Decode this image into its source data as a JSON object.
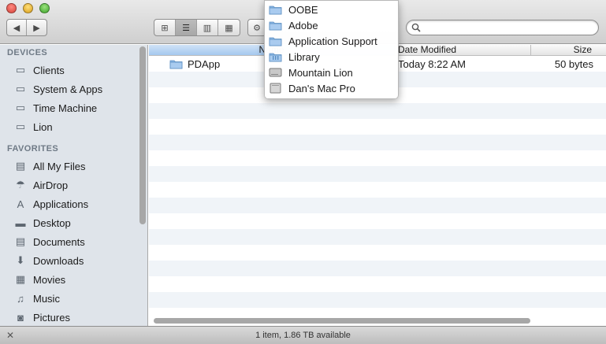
{
  "toolbar": {
    "nav_back": "◀",
    "nav_forward": "▶",
    "view_icon": "⊞",
    "view_list": "☰",
    "view_columns": "▥",
    "view_coverflow": "▦",
    "action": "⚙",
    "search_placeholder": "",
    "search_value": ""
  },
  "sidebar": {
    "devices_heading": "DEVICES",
    "devices": [
      {
        "label": "Clients",
        "icon": "hdd-icon"
      },
      {
        "label": "System & Apps",
        "icon": "hdd-icon"
      },
      {
        "label": "Time Machine",
        "icon": "hdd-icon"
      },
      {
        "label": "Lion",
        "icon": "hdd-icon"
      }
    ],
    "favorites_heading": "FAVORITES",
    "favorites": [
      {
        "label": "All My Files",
        "icon": "all-files-icon"
      },
      {
        "label": "AirDrop",
        "icon": "airdrop-icon"
      },
      {
        "label": "Applications",
        "icon": "applications-icon"
      },
      {
        "label": "Desktop",
        "icon": "desktop-icon"
      },
      {
        "label": "Documents",
        "icon": "documents-icon"
      },
      {
        "label": "Downloads",
        "icon": "downloads-icon"
      },
      {
        "label": "Movies",
        "icon": "movies-icon"
      },
      {
        "label": "Music",
        "icon": "music-icon"
      },
      {
        "label": "Pictures",
        "icon": "pictures-icon"
      }
    ]
  },
  "columns": {
    "name": "Name",
    "date": "Date Modified",
    "size": "Size"
  },
  "files": [
    {
      "name": "PDApp",
      "date": "Today 8:22 AM",
      "size": "50 bytes"
    }
  ],
  "path_popup": [
    {
      "label": "OOBE",
      "icon": "folder-icon"
    },
    {
      "label": "Adobe",
      "icon": "folder-icon"
    },
    {
      "label": "Application Support",
      "icon": "folder-icon"
    },
    {
      "label": "Library",
      "icon": "library-folder-icon"
    },
    {
      "label": "Mountain Lion",
      "icon": "hdd-icon"
    },
    {
      "label": "Dan's Mac Pro",
      "icon": "computer-icon"
    }
  ],
  "status": {
    "text": "1 item, 1.86 TB available"
  },
  "colors": {
    "accent": "#a5c8ee",
    "sidebar_bg": "#dfe4ea",
    "row_alt": "#f0f4f8"
  }
}
